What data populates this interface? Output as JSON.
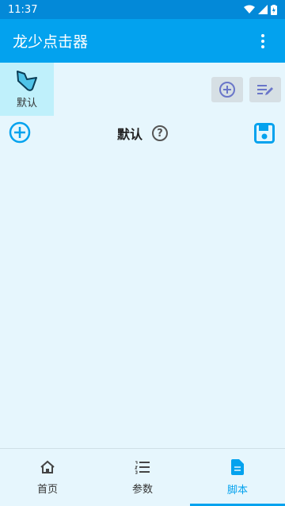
{
  "status": {
    "time": "11:37"
  },
  "app": {
    "title": "龙少点击器"
  },
  "folder": {
    "label": "默认"
  },
  "script": {
    "title": "默认"
  },
  "nav": {
    "items": [
      {
        "label": "首页",
        "icon": "home-icon",
        "active": false
      },
      {
        "label": "参数",
        "icon": "list-icon",
        "active": false
      },
      {
        "label": "脚本",
        "icon": "document-icon",
        "active": true
      }
    ]
  },
  "colors": {
    "primary": "#03a2ee",
    "status_bar": "#0389d8",
    "background": "#e6f6fd",
    "folder_bg": "#bff0fb"
  }
}
